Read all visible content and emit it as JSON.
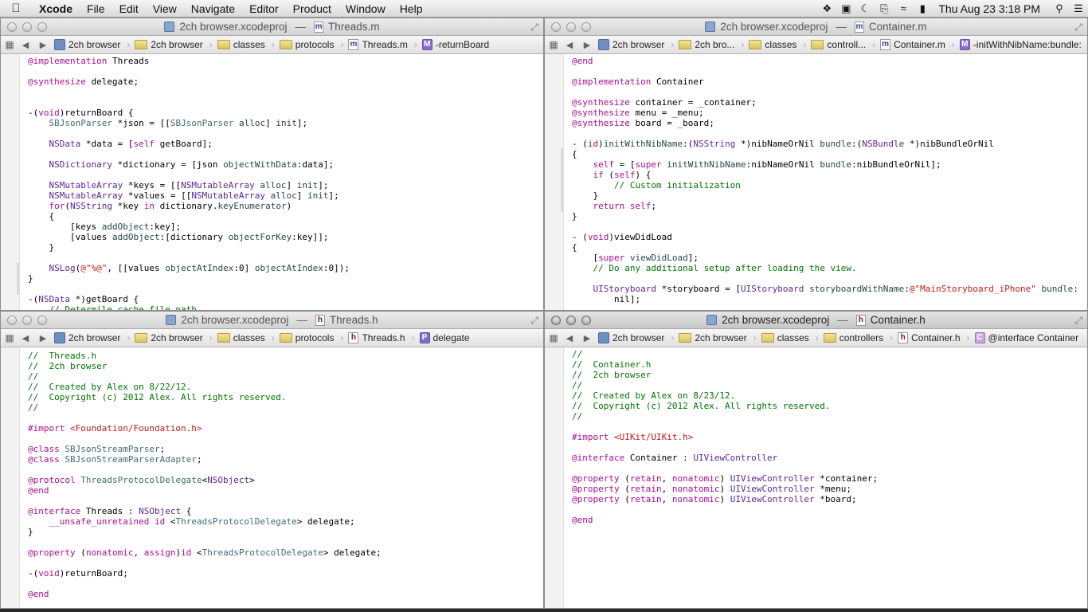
{
  "menubar": {
    "app": "Xcode",
    "items": [
      "File",
      "Edit",
      "View",
      "Navigate",
      "Editor",
      "Product",
      "Window",
      "Help"
    ],
    "clock": "Thu Aug 23  3:18 PM"
  },
  "windows": {
    "tl": {
      "project": "2ch browser.xcodeproj",
      "file": "Threads.m",
      "crumbs": [
        "2ch browser",
        "2ch browser",
        "classes",
        "protocols",
        "Threads.m",
        "-returnBoard"
      ]
    },
    "tr": {
      "project": "2ch browser.xcodeproj",
      "file": "Container.m",
      "crumbs": [
        "2ch browser",
        "2ch bro...",
        "classes",
        "controll...",
        "Container.m",
        "-initWithNibName:bundle:"
      ]
    },
    "bl": {
      "project": "2ch browser.xcodeproj",
      "file": "Threads.h",
      "crumbs": [
        "2ch browser",
        "2ch browser",
        "classes",
        "protocols",
        "Threads.h",
        "delegate"
      ]
    },
    "br": {
      "project": "2ch browser.xcodeproj",
      "file": "Container.h",
      "crumbs": [
        "2ch browser",
        "2ch browser",
        "classes",
        "controllers",
        "Container.h",
        "@interface Container"
      ]
    }
  },
  "code": {
    "tl": [
      "@implementation Threads",
      "",
      "@synthesize delegate;",
      "",
      "",
      "-(void)returnBoard {",
      "    SBJsonParser *json = [[SBJsonParser alloc] init];",
      "",
      "    NSData *data = [self getBoard];",
      "",
      "    NSDictionary *dictionary = [json objectWithData:data];",
      "",
      "    NSMutableArray *keys = [[NSMutableArray alloc] init];",
      "    NSMutableArray *values = [[NSMutableArray alloc] init];",
      "    for(NSString *key in dictionary.keyEnumerator)",
      "    {",
      "        [keys addObject:key];",
      "        [values addObject:[dictionary objectForKey:key]];",
      "    }",
      "",
      "    NSLog(@\"%@\", [[values objectAtIndex:0] objectAtIndex:0]);",
      "}",
      "",
      "-(NSData *)getBoard {",
      "    // Determile cache file path"
    ],
    "tr": [
      "@end",
      "",
      "@implementation Container",
      "",
      "@synthesize container = _container;",
      "@synthesize menu = _menu;",
      "@synthesize board = _board;",
      "",
      "- (id)initWithNibName:(NSString *)nibNameOrNil bundle:(NSBundle *)nibBundleOrNil",
      "{",
      "    self = [super initWithNibName:nibNameOrNil bundle:nibBundleOrNil];",
      "    if (self) {",
      "        // Custom initialization",
      "    }",
      "    return self;",
      "}",
      "",
      "- (void)viewDidLoad",
      "{",
      "    [super viewDidLoad];",
      "    // Do any additional setup after loading the view.",
      "",
      "    UIStoryboard *storyboard = [UIStoryboard storyboardWithName:@\"MainStoryboard_iPhone\" bundle:",
      "        nil];"
    ],
    "bl": [
      "//  Threads.h",
      "//  2ch browser",
      "//",
      "//  Created by Alex on 8/22/12.",
      "//  Copyright (c) 2012 Alex. All rights reserved.",
      "//",
      "",
      "#import <Foundation/Foundation.h>",
      "",
      "@class SBJsonStreamParser;",
      "@class SBJsonStreamParserAdapter;",
      "",
      "@protocol ThreadsProtocolDelegate<NSObject>",
      "@end",
      "",
      "@interface Threads : NSObject {",
      "    __unsafe_unretained id <ThreadsProtocolDelegate> delegate;",
      "}",
      "",
      "@property (nonatomic, assign)id <ThreadsProtocolDelegate> delegate;",
      "",
      "-(void)returnBoard;",
      "",
      "@end"
    ],
    "br": [
      "//",
      "//  Container.h",
      "//  2ch browser",
      "//",
      "//  Created by Alex on 8/23/12.",
      "//  Copyright (c) 2012 Alex. All rights reserved.",
      "//",
      "",
      "#import <UIKit/UIKit.h>",
      "",
      "@interface Container : UIViewController",
      "",
      "@property (retain, nonatomic) UIViewController *container;",
      "@property (retain, nonatomic) UIViewController *menu;",
      "@property (retain, nonatomic) UIViewController *board;",
      "",
      "@end"
    ]
  }
}
